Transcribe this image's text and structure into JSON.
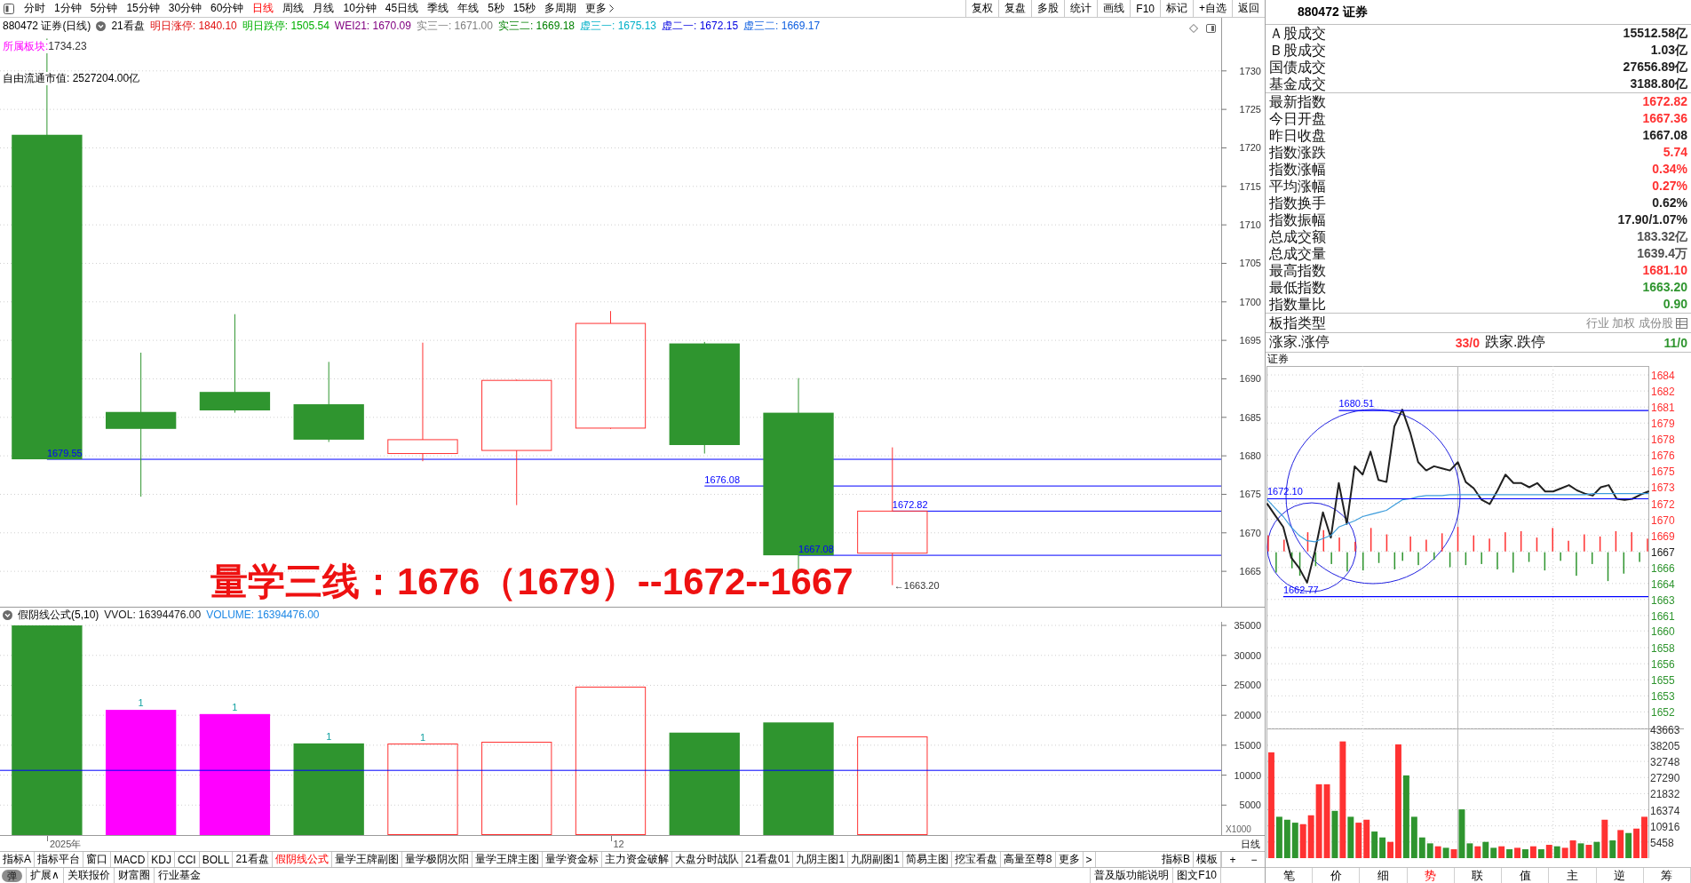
{
  "toolbar": {
    "periods": [
      {
        "label": "分时",
        "selected": false
      },
      {
        "label": "1分钟",
        "selected": false
      },
      {
        "label": "5分钟",
        "selected": false
      },
      {
        "label": "15分钟",
        "selected": false
      },
      {
        "label": "30分钟",
        "selected": false
      },
      {
        "label": "60分钟",
        "selected": false
      },
      {
        "label": "日线",
        "selected": true
      },
      {
        "label": "周线",
        "selected": false
      },
      {
        "label": "月线",
        "selected": false
      },
      {
        "label": "10分钟",
        "selected": false
      },
      {
        "label": "45日线",
        "selected": false
      },
      {
        "label": "季线",
        "selected": false
      },
      {
        "label": "年线",
        "selected": false
      },
      {
        "label": "5秒",
        "selected": false
      },
      {
        "label": "15秒",
        "selected": false
      },
      {
        "label": "多周期",
        "selected": false
      }
    ],
    "more": "更多",
    "actions": [
      "复权",
      "复盘",
      "多股",
      "统计",
      "画线",
      "F10",
      "标记",
      "+自选",
      "返回"
    ]
  },
  "chart_header": {
    "title": "880472 证券(日线)",
    "template": "21看盘",
    "readings": [
      {
        "text": "明日涨停: 1840.10",
        "color": "#e01010"
      },
      {
        "text": "明日跌停: 1505.54",
        "color": "#00b000"
      },
      {
        "text": "WEI21: 1670.09",
        "color": "#800080"
      },
      {
        "text": "实三一: 1671.00",
        "color": "#808080"
      },
      {
        "text": "实三二: 1669.18",
        "color": "#008000"
      },
      {
        "text": "虚三一: 1675.13",
        "color": "#00b0c8"
      },
      {
        "text": "虚二一: 1672.15",
        "color": "#0000e0"
      },
      {
        "text": "虚三二: 1669.17",
        "color": "#1060e0"
      }
    ],
    "sector_label": "所属板块:",
    "sector_value": "1734.23",
    "float_cap": "自由流通市值: 2527204.00亿"
  },
  "main_chart": {
    "overlay_text": "量学三线：1676（1679）--1672--1667",
    "chart_data": {
      "type": "candlestick",
      "categories": [
        null,
        null,
        null,
        null,
        null,
        null,
        null,
        null,
        null,
        null,
        null,
        null,
        null
      ],
      "ohlc": [
        [
          1721.7,
          1734.2,
          1679.55,
          1679.55
        ],
        [
          1685.7,
          1693.4,
          1674.7,
          1683.5
        ],
        [
          1688.3,
          1698.4,
          1685.6,
          1685.9
        ],
        [
          1686.7,
          1692.2,
          1681.8,
          1682.1
        ],
        [
          1680.3,
          1694.7,
          1679.3,
          1682.1
        ],
        [
          1680.7,
          1689.9,
          1673.6,
          1689.8
        ],
        [
          1683.6,
          1698.8,
          1683.5,
          1697.2
        ],
        [
          1694.6,
          1694.8,
          1680.3,
          1681.4
        ],
        [
          1685.6,
          1690.1,
          1665.0,
          1667.08
        ],
        [
          1667.36,
          1681.1,
          1663.2,
          1672.82
        ],
        null,
        null,
        null
      ],
      "ylim": [
        1660.4,
        1736.9
      ],
      "yticks": [
        1665,
        1670,
        1675,
        1680,
        1685,
        1690,
        1695,
        1700,
        1705,
        1710,
        1715,
        1720,
        1725,
        1730
      ],
      "grid": true,
      "ref_lines": [
        {
          "axis": "y",
          "value": 1679.55,
          "label": "1679.55",
          "color": "#0000ff"
        },
        {
          "axis": "y",
          "value": 1676.08,
          "label": "1676.08",
          "color": "#0000ff"
        },
        {
          "axis": "y",
          "value": 1672.82,
          "label": "1672.82",
          "color": "#0000ff"
        },
        {
          "axis": "y",
          "value": 1667.08,
          "label": "1667.08",
          "color": "#0000ff"
        }
      ],
      "annotations": [
        "←1663.20"
      ]
    }
  },
  "volume_panel": {
    "title": "假阴线公式(5,10)",
    "readings": [
      {
        "text": "VVOL: 16394476.00",
        "color": "#202020"
      },
      {
        "text": "VOLUME: 16394476.00",
        "color": "#1e88e5"
      }
    ],
    "unit": "X1000",
    "period": "日线",
    "chart_data": {
      "type": "bar",
      "categories": [
        "2025年",
        null,
        null,
        null,
        null,
        null,
        "12",
        null,
        null,
        null,
        null,
        null,
        null
      ],
      "values": [
        35000,
        20900,
        20200,
        15300,
        15200,
        15500,
        24700,
        17100,
        18800,
        16400,
        null,
        null,
        null
      ],
      "colors": [
        "#2f952f",
        "#ff00ff",
        "#ff00ff",
        "#2f952f",
        "#ff3232",
        "#ff3232",
        "#ff3232",
        "#2f952f",
        "#2f952f",
        "#ff3232",
        null,
        null,
        null
      ],
      "ylim": [
        0,
        35600
      ],
      "yticks": [
        5000,
        10000,
        15000,
        20000,
        25000,
        30000,
        35000
      ],
      "grid": true,
      "ref_lines": [
        {
          "axis": "y",
          "value": 10800,
          "color": "#0000ff"
        }
      ],
      "annotations": [
        "1",
        "1",
        "1",
        "1"
      ]
    }
  },
  "indicator_tabs": [
    {
      "label": "指标A",
      "selected": false
    },
    {
      "label": "指标平台",
      "selected": false
    },
    {
      "label": "窗口",
      "selected": false
    },
    {
      "label": "MACD",
      "selected": false
    },
    {
      "label": "KDJ",
      "selected": false
    },
    {
      "label": "CCI",
      "selected": false
    },
    {
      "label": "BOLL",
      "selected": false
    },
    {
      "label": "21看盘",
      "selected": false
    },
    {
      "label": "假阴线公式",
      "selected": true
    },
    {
      "label": "量学王牌副图",
      "selected": false
    },
    {
      "label": "量学极阴次阳",
      "selected": false
    },
    {
      "label": "量学王牌主图",
      "selected": false
    },
    {
      "label": "量学资金标",
      "selected": false
    },
    {
      "label": "主力资金破解",
      "selected": false
    },
    {
      "label": "大盘分时战队",
      "selected": false
    },
    {
      "label": "21看盘01",
      "selected": false
    },
    {
      "label": "九阴主图1",
      "selected": false
    },
    {
      "label": "九阴副图1",
      "selected": false
    },
    {
      "label": "简易主图",
      "selected": false
    },
    {
      "label": "挖宝看盘",
      "selected": false
    },
    {
      "label": "高量至尊8",
      "selected": false
    }
  ],
  "tab_more": "更多",
  "tab_arrow": ">",
  "side_buttons": [
    "指标B",
    "模板"
  ],
  "zoom_buttons": [
    "+",
    "−"
  ],
  "bottom_bar": {
    "toggle": "弹",
    "links": [
      "扩展∧",
      "关联报价",
      "财富圈",
      "行业基金"
    ],
    "right_links": [
      "普及版功能说明",
      "图文F10"
    ]
  },
  "quote_panel": {
    "title": "880472 证券",
    "market_rows": [
      {
        "label": "Ａ股成交",
        "value": "15512.58亿"
      },
      {
        "label": "Ｂ股成交",
        "value": "1.03亿"
      },
      {
        "label": "国债成交",
        "value": "27656.89亿"
      },
      {
        "label": "基金成交",
        "value": "3188.80亿"
      }
    ],
    "index_rows": [
      {
        "label": "最新指数",
        "value": "1672.82",
        "color": "#ff3232"
      },
      {
        "label": "今日开盘",
        "value": "1667.36",
        "color": "#ff3232"
      },
      {
        "label": "昨日收盘",
        "value": "1667.08",
        "color": "#202020"
      },
      {
        "label": "指数涨跌",
        "value": "5.74",
        "color": "#ff3232"
      },
      {
        "label": "指数涨幅",
        "value": "0.34%",
        "color": "#ff3232"
      },
      {
        "label": "平均涨幅",
        "value": "0.27%",
        "color": "#ff3232"
      },
      {
        "label": "指数换手",
        "value": "0.62%",
        "color": "#202020"
      },
      {
        "label": "指数振幅",
        "value": "17.90/1.07%",
        "color": "#202020"
      },
      {
        "label": "总成交额",
        "value": "183.32亿",
        "color": "#505050"
      },
      {
        "label": "总成交量",
        "value": "1639.4万",
        "color": "#505050"
      },
      {
        "label": "最高指数",
        "value": "1681.10",
        "color": "#ff3232"
      },
      {
        "label": "最低指数",
        "value": "1663.20",
        "color": "#2f952f"
      },
      {
        "label": "指数量比",
        "value": "0.90",
        "color": "#2f952f"
      }
    ],
    "index_type": {
      "label": "板指类型",
      "value": "行业 加权 成份股"
    },
    "breadth": {
      "up_label": "涨家.涨停",
      "up_value": "33/0",
      "down_label": "跌家.跌停",
      "down_value": "11/0"
    }
  },
  "intraday": {
    "title": "证券",
    "chart_data": [
      {
        "type": "line",
        "categories": [
          null,
          null,
          null,
          null,
          null,
          null,
          null,
          null,
          null,
          null,
          null,
          null,
          null,
          null,
          null,
          null,
          null,
          null,
          null,
          null,
          null,
          null,
          null,
          null,
          null,
          null,
          null,
          null,
          null,
          null,
          null,
          null,
          null,
          null,
          null,
          null,
          null,
          null,
          null,
          null,
          null,
          null,
          null,
          null,
          null,
          null,
          null,
          null,
          null
        ],
        "series": [
          {
            "color": "#202020",
            "values": [
              1671.6,
              1670.5,
              1669.4,
              1666.5,
              1665.5,
              1664.1,
              1667.1,
              1670.8,
              1668.4,
              1673.6,
              1669.7,
              1675.2,
              1674.4,
              1676.6,
              1673.9,
              1673.7,
              1679.0,
              1680.6,
              1678.4,
              1675.6,
              1674.8,
              1675.2,
              1675.0,
              1674.8,
              1675.6,
              1673.7,
              1673.1,
              1672.0,
              1671.6,
              1672.9,
              1674.4,
              1673.6,
              1673.6,
              1673.2,
              1673.6,
              1672.8,
              1672.8,
              1673.1,
              1673.4,
              1672.9,
              1672.6,
              1672.4,
              1673.2,
              1673.4,
              1672.1,
              1672.0,
              1672.1,
              1672.5,
              1672.8
            ]
          },
          {
            "color": "#3c9cdc",
            "values": [
              1672.0,
              1671.2,
              1670.4,
              1669.4,
              1668.6,
              1668.1,
              1668.0,
              1668.3,
              1668.6,
              1669.4,
              1669.7,
              1670.0,
              1670.4,
              1670.6,
              1670.8,
              1671.0,
              1671.5,
              1672.0,
              1672.1,
              1672.3,
              1672.4,
              1672.4,
              1672.4,
              1672.5,
              1672.5,
              1672.5,
              1672.5,
              1672.5,
              1672.5,
              1672.5,
              1672.5,
              1672.5,
              1672.5,
              1672.5,
              1672.5,
              1672.5,
              1672.5,
              1672.5,
              1672.5,
              1672.5,
              1672.5,
              1672.6,
              1672.6,
              1672.6,
              1672.6,
              1672.6,
              1672.6,
              1672.6,
              1672.6
            ]
          }
        ],
        "ylim": [
          1650.2,
          1684.0
        ],
        "yticks": [
          {
            "value": 1651.78,
            "label": "1652"
          },
          {
            "value": 1653.31,
            "label": "1653"
          },
          {
            "value": 1654.84,
            "label": "1655"
          },
          {
            "value": 1656.37,
            "label": "1656"
          },
          {
            "value": 1657.9,
            "label": "1658"
          },
          {
            "value": 1659.5,
            "label": "1660"
          },
          {
            "value": 1660.96,
            "label": "1661"
          },
          {
            "value": 1662.5,
            "label": "1663"
          },
          {
            "value": 1664.02,
            "label": "1664"
          },
          {
            "value": 1665.55,
            "label": "1666"
          },
          {
            "value": 1667.08,
            "label": "1667"
          },
          {
            "value": 1668.61,
            "label": "1669"
          },
          {
            "value": 1670.14,
            "label": "1670"
          },
          {
            "value": 1671.67,
            "label": "1672"
          },
          {
            "value": 1673.2,
            "label": "1673"
          },
          {
            "value": 1674.73,
            "label": "1675"
          },
          {
            "value": 1676.26,
            "label": "1676"
          },
          {
            "value": 1677.79,
            "label": "1678"
          },
          {
            "value": 1679.32,
            "label": "1679"
          },
          {
            "value": 1680.85,
            "label": "1681"
          },
          {
            "value": 1682.38,
            "label": "1682"
          },
          {
            "value": 1683.91,
            "label": "1684"
          }
        ],
        "grid": true,
        "ref_lines": [
          {
            "axis": "y",
            "value": 1680.51,
            "label": "1680.51",
            "color": "#0000ff"
          },
          {
            "axis": "y",
            "value": 1672.1,
            "label": "1672.10",
            "color": "#0000ff"
          },
          {
            "axis": "y",
            "value": 1662.77,
            "label": "1662.77",
            "color": "#0000ff"
          }
        ]
      },
      {
        "type": "bar",
        "categories": [
          null,
          null,
          null,
          null,
          null,
          null,
          null,
          null,
          null,
          null,
          null,
          null,
          null,
          null,
          null,
          null,
          null,
          null,
          null,
          null,
          null,
          null,
          null,
          null,
          null,
          null,
          null,
          null,
          null,
          null,
          null,
          null,
          null,
          null,
          null,
          null,
          null,
          null,
          null,
          null,
          null,
          null,
          null,
          null,
          null,
          null,
          null,
          null
        ],
        "values": [
          35800,
          14000,
          13000,
          12000,
          11500,
          14500,
          25000,
          25000,
          16000,
          39500,
          14000,
          12000,
          13000,
          9000,
          7000,
          5500,
          38500,
          28000,
          14000,
          7000,
          5000,
          4000,
          3500,
          3000,
          16500,
          5000,
          4000,
          5500,
          3500,
          4000,
          3000,
          3500,
          3000,
          4000,
          3000,
          4500,
          4000,
          3500,
          6000,
          5000,
          4500,
          5500,
          13000,
          6000,
          9500,
          8500,
          10000,
          14000
        ],
        "colors": [
          "#ff3232",
          "#2f952f",
          "#2f952f",
          "#2f952f",
          "#ff3232",
          "#ff3232",
          "#ff3232",
          "#ff3232",
          "#2f952f",
          "#ff3232",
          "#2f952f",
          "#ff3232",
          "#ff3232",
          "#2f952f",
          "#2f952f",
          "#ff3232",
          "#ff3232",
          "#2f952f",
          "#2f952f",
          "#2f952f",
          "#2f952f",
          "#ff3232",
          "#2f952f",
          "#ff3232",
          "#2f952f",
          "#2f952f",
          "#ff3232",
          "#2f952f",
          "#2f952f",
          "#ff3232",
          "#2f952f",
          "#ff3232",
          "#2f952f",
          "#ff3232",
          "#2f952f",
          "#ff3232",
          "#2f952f",
          "#ff3232",
          "#ff3232",
          "#2f952f",
          "#ff3232",
          "#2f952f",
          "#ff3232",
          "#2f952f",
          "#ff3232",
          "#2f952f",
          "#ff3232",
          "#ff3232"
        ],
        "ylim": [
          0,
          43900
        ],
        "yticks": [
          5458,
          10916,
          16374,
          21832,
          27290,
          32748,
          38205,
          43663
        ],
        "grid": true
      }
    ]
  },
  "quote_tabs": [
    {
      "label": "笔",
      "selected": false
    },
    {
      "label": "价",
      "selected": false
    },
    {
      "label": "细",
      "selected": false
    },
    {
      "label": "势",
      "selected": true
    },
    {
      "label": "联",
      "selected": false
    },
    {
      "label": "值",
      "selected": false
    },
    {
      "label": "主",
      "selected": false
    },
    {
      "label": "逆",
      "selected": false
    },
    {
      "label": "筹",
      "selected": false
    }
  ]
}
